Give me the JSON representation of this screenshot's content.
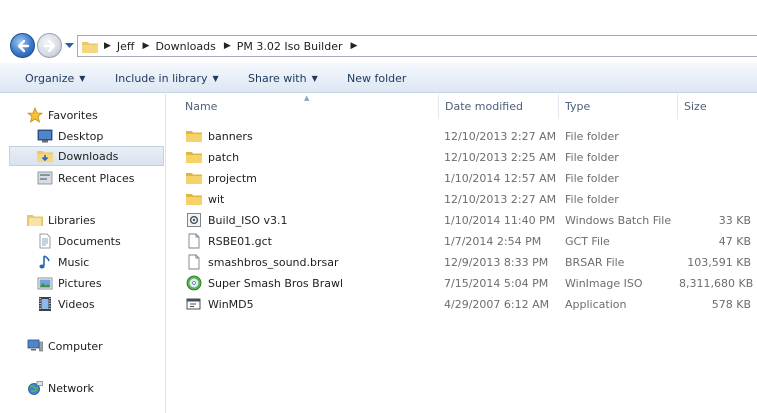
{
  "address": {
    "crumbs": [
      "Jeff",
      "Downloads",
      "PM 3.02 Iso Builder"
    ]
  },
  "toolbar": {
    "organize": "Organize",
    "include_in_library": "Include in library",
    "share_with": "Share with",
    "new_folder": "New folder"
  },
  "nav": {
    "favorites": "Favorites",
    "desktop": "Desktop",
    "downloads": "Downloads",
    "recent_places": "Recent Places",
    "libraries": "Libraries",
    "documents": "Documents",
    "music": "Music",
    "pictures": "Pictures",
    "videos": "Videos",
    "computer": "Computer",
    "network": "Network"
  },
  "columns": {
    "name": "Name",
    "date_modified": "Date modified",
    "type": "Type",
    "size": "Size"
  },
  "files": [
    {
      "name": "banners",
      "date": "12/10/2013 2:27 AM",
      "type": "File folder",
      "size": "",
      "icon": "folder-icon"
    },
    {
      "name": "patch",
      "date": "12/10/2013 2:25 AM",
      "type": "File folder",
      "size": "",
      "icon": "folder-icon"
    },
    {
      "name": "projectm",
      "date": "1/10/2014 12:57 AM",
      "type": "File folder",
      "size": "",
      "icon": "folder-icon"
    },
    {
      "name": "wit",
      "date": "12/10/2013 2:27 AM",
      "type": "File folder",
      "size": "",
      "icon": "folder-icon"
    },
    {
      "name": "Build_ISO v3.1",
      "date": "1/10/2014 11:40 PM",
      "type": "Windows Batch File",
      "size": "33 KB",
      "icon": "batch-file-icon"
    },
    {
      "name": "RSBE01.gct",
      "date": "1/7/2014 2:54 PM",
      "type": "GCT File",
      "size": "47 KB",
      "icon": "file-icon"
    },
    {
      "name": "smashbros_sound.brsar",
      "date": "12/9/2013 8:33 PM",
      "type": "BRSAR File",
      "size": "103,591 KB",
      "icon": "file-icon"
    },
    {
      "name": "Super Smash Bros Brawl",
      "date": "7/15/2014 5:04 PM",
      "type": "WinImage ISO",
      "size": "8,311,680 KB",
      "icon": "disc-icon"
    },
    {
      "name": "WinMD5",
      "date": "4/29/2007 6:12 AM",
      "type": "Application",
      "size": "578 KB",
      "icon": "application-icon"
    }
  ]
}
